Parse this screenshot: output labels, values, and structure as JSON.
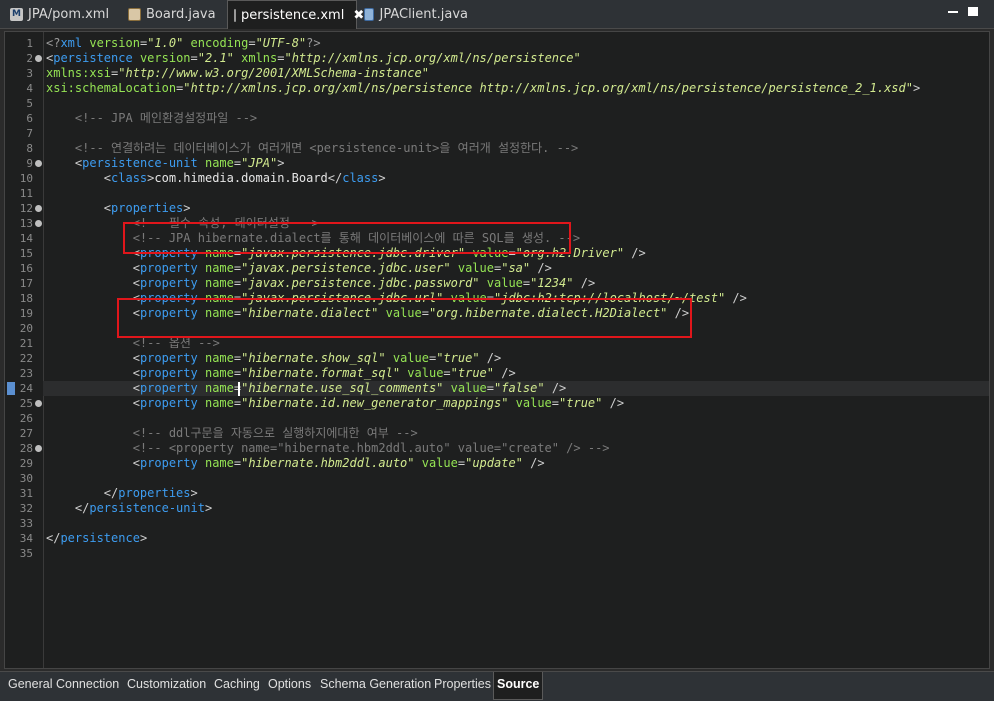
{
  "editor_tabs": [
    {
      "label": "JPA/pom.xml",
      "icon": "maven-file-icon",
      "active": false
    },
    {
      "label": "Board.java",
      "icon": "java-file-icon",
      "active": false
    },
    {
      "label": "persistence.xml",
      "icon": "xml-file-icon",
      "active": true,
      "close": "✖"
    },
    {
      "label": "JPAClient.java",
      "icon": "java-file-icon",
      "active": false
    }
  ],
  "code_lines": [
    {
      "num": "1",
      "html": "<span class='c-pi'>&lt;?</span><span class='c-tag'>xml</span> <span class='c-attr'>version</span><span class='c-punc'>=</span><span class='c-val'>\"1.0\"</span> <span class='c-attr'>encoding</span><span class='c-punc'>=</span><span class='c-val'>\"UTF-8\"</span><span class='c-pi'>?&gt;</span>"
    },
    {
      "num": "2",
      "fold": true,
      "html": "<span class='c-punc'>&lt;</span><span class='c-tag'>persistence</span> <span class='c-attr'>version</span><span class='c-punc'>=</span><span class='c-val'>\"2.1\"</span> <span class='c-attr'>xmlns</span><span class='c-punc'>=</span><span class='c-val'>\"http://xmlns.jcp.org/xml/ns/persistence\"</span>"
    },
    {
      "num": "3",
      "html": "<span class='c-attr'>xmlns:xsi</span><span class='c-punc'>=</span><span class='c-val'>\"http://www.w3.org/2001/XMLSchema-instance\"</span>"
    },
    {
      "num": "4",
      "html": "<span class='c-attr'>xsi:schemaLocation</span><span class='c-punc'>=</span><span class='c-val'>\"http://xmlns.jcp.org/xml/ns/persistence http://xmlns.jcp.org/xml/ns/persistence/persistence_2_1.xsd\"</span><span class='c-punc'>&gt;</span>"
    },
    {
      "num": "5",
      "html": ""
    },
    {
      "num": "6",
      "html": "    <span class='c-com'>&lt;!-- JPA 메인환경설정파일 --&gt;</span>"
    },
    {
      "num": "7",
      "html": ""
    },
    {
      "num": "8",
      "html": "    <span class='c-com'>&lt;!-- 연결하려는 데이터베이스가 여러개면 &lt;persistence-unit&gt;을 여러개 설정한다. --&gt;</span>"
    },
    {
      "num": "9",
      "fold": true,
      "html": "    <span class='c-punc'>&lt;</span><span class='c-tag'>persistence-unit</span> <span class='c-attr'>name</span><span class='c-punc'>=</span><span class='c-val'>\"JPA\"</span><span class='c-punc'>&gt;</span>"
    },
    {
      "num": "10",
      "html": "        <span class='c-punc'>&lt;</span><span class='c-tag'>class</span><span class='c-punc'>&gt;</span><span class='c-txt'>com.himedia.domain.Board</span><span class='c-punc'>&lt;/</span><span class='c-tag'>class</span><span class='c-punc'>&gt;</span>"
    },
    {
      "num": "11",
      "html": ""
    },
    {
      "num": "12",
      "fold": true,
      "html": "        <span class='c-punc'>&lt;</span><span class='c-tag'>properties</span><span class='c-punc'>&gt;</span>"
    },
    {
      "num": "13",
      "fold": true,
      "html": "            <span class='c-com'>&lt;!-- 필수 속성, 데이터설정 --&gt;</span>"
    },
    {
      "num": "14",
      "html": "            <span class='c-com'>&lt;!-- JPA hibernate.dialect를 통해 데이터베이스에 따른 SQL를 생성. --&gt;</span>"
    },
    {
      "num": "15",
      "html": "            <span class='c-punc'>&lt;</span><span class='c-tag'>property</span> <span class='c-attr'>name</span><span class='c-punc'>=</span><span class='c-val'>\"javax.persistence.jdbc.driver\"</span> <span class='c-attr'>value</span><span class='c-punc'>=</span><span class='c-val'>\"org.h2.Driver\"</span> <span class='c-punc'>/&gt;</span>"
    },
    {
      "num": "16",
      "html": "            <span class='c-punc'>&lt;</span><span class='c-tag'>property</span> <span class='c-attr'>name</span><span class='c-punc'>=</span><span class='c-val'>\"javax.persistence.jdbc.user\"</span> <span class='c-attr'>value</span><span class='c-punc'>=</span><span class='c-val'>\"sa\"</span> <span class='c-punc'>/&gt;</span>"
    },
    {
      "num": "17",
      "html": "            <span class='c-punc'>&lt;</span><span class='c-tag'>property</span> <span class='c-attr'>name</span><span class='c-punc'>=</span><span class='c-val'>\"javax.persistence.jdbc.password\"</span> <span class='c-attr'>value</span><span class='c-punc'>=</span><span class='c-val'>\"1234\"</span> <span class='c-punc'>/&gt;</span>"
    },
    {
      "num": "18",
      "html": "            <span class='c-punc'>&lt;</span><span class='c-tag'>property</span> <span class='c-attr'>name</span><span class='c-punc'>=</span><span class='c-val'>\"javax.persistence.jdbc.url\"</span> <span class='c-attr'>value</span><span class='c-punc'>=</span><span class='c-val'>\"jdbc:h2:tcp://localhost/~/test\"</span> <span class='c-punc'>/&gt;</span>"
    },
    {
      "num": "19",
      "html": "            <span class='c-punc'>&lt;</span><span class='c-tag'>property</span> <span class='c-attr'>name</span><span class='c-punc'>=</span><span class='c-val'>\"hibernate.dialect\"</span> <span class='c-attr'>value</span><span class='c-punc'>=</span><span class='c-val'>\"org.hibernate.dialect.H2Dialect\"</span> <span class='c-punc'>/&gt;</span>"
    },
    {
      "num": "20",
      "html": ""
    },
    {
      "num": "21",
      "html": "            <span class='c-com'>&lt;!-- 옵션 --&gt;</span>"
    },
    {
      "num": "22",
      "html": "            <span class='c-punc'>&lt;</span><span class='c-tag'>property</span> <span class='c-attr'>name</span><span class='c-punc'>=</span><span class='c-val'>\"hibernate.show_sql\"</span> <span class='c-attr'>value</span><span class='c-punc'>=</span><span class='c-val'>\"true\"</span> <span class='c-punc'>/&gt;</span>"
    },
    {
      "num": "23",
      "html": "            <span class='c-punc'>&lt;</span><span class='c-tag'>property</span> <span class='c-attr'>name</span><span class='c-punc'>=</span><span class='c-val'>\"hibernate.format_sql\"</span> <span class='c-attr'>value</span><span class='c-punc'>=</span><span class='c-val'>\"true\"</span> <span class='c-punc'>/&gt;</span>"
    },
    {
      "num": "24",
      "current": true,
      "marker": true,
      "html": "            <span class='c-punc'>&lt;</span><span class='c-tag'>property</span> <span class='c-attr'>name</span><span class='c-punc'>=</span><span class='c-val'>\"hibernate.use_sql_comments\"</span> <span class='c-attr'>value</span><span class='c-punc'>=</span><span class='c-val'>\"false\"</span> <span class='c-punc'>/&gt;</span>"
    },
    {
      "num": "25",
      "fold": true,
      "html": "            <span class='c-punc'>&lt;</span><span class='c-tag'>property</span> <span class='c-attr'>name</span><span class='c-punc'>=</span><span class='c-val'>\"hibernate.id.new_generator_mappings\"</span> <span class='c-attr'>value</span><span class='c-punc'>=</span><span class='c-val'>\"true\"</span> <span class='c-punc'>/&gt;</span>"
    },
    {
      "num": "26",
      "html": ""
    },
    {
      "num": "27",
      "html": "            <span class='c-com'>&lt;!-- ddl구문을 자동으로 실행하지에대한 여부 --&gt;</span>"
    },
    {
      "num": "28",
      "fold": true,
      "html": "            <span class='c-com'>&lt;!-- &lt;property name=\"hibernate.hbm2ddl.auto\" value=\"create\" /&gt; --&gt;</span>"
    },
    {
      "num": "29",
      "html": "            <span class='c-punc'>&lt;</span><span class='c-tag'>property</span> <span class='c-attr'>name</span><span class='c-punc'>=</span><span class='c-val'>\"hibernate.hbm2ddl.auto\"</span> <span class='c-attr'>value</span><span class='c-punc'>=</span><span class='c-val'>\"update\"</span> <span class='c-punc'>/&gt;</span>"
    },
    {
      "num": "30",
      "html": ""
    },
    {
      "num": "31",
      "html": "        <span class='c-punc'>&lt;/</span><span class='c-tag'>properties</span><span class='c-punc'>&gt;</span>"
    },
    {
      "num": "32",
      "html": "    <span class='c-punc'>&lt;/</span><span class='c-tag'>persistence-unit</span><span class='c-punc'>&gt;</span>"
    },
    {
      "num": "33",
      "html": ""
    },
    {
      "num": "34",
      "html": "<span class='c-punc'>&lt;/</span><span class='c-tag'>persistence</span><span class='c-punc'>&gt;</span>"
    },
    {
      "num": "35",
      "html": ""
    }
  ],
  "bottom_tabs": [
    "General",
    "Connection",
    "Customization",
    "Caching",
    "Options",
    "Schema Generation",
    "Properties",
    "Source"
  ],
  "active_bottom_tab": "Source",
  "colors": {
    "highlight_box": "#e0161b",
    "tag": "#3d9cf0",
    "attribute": "#95e454",
    "value": "#d2ea8f",
    "comment": "#7a7a7a"
  }
}
